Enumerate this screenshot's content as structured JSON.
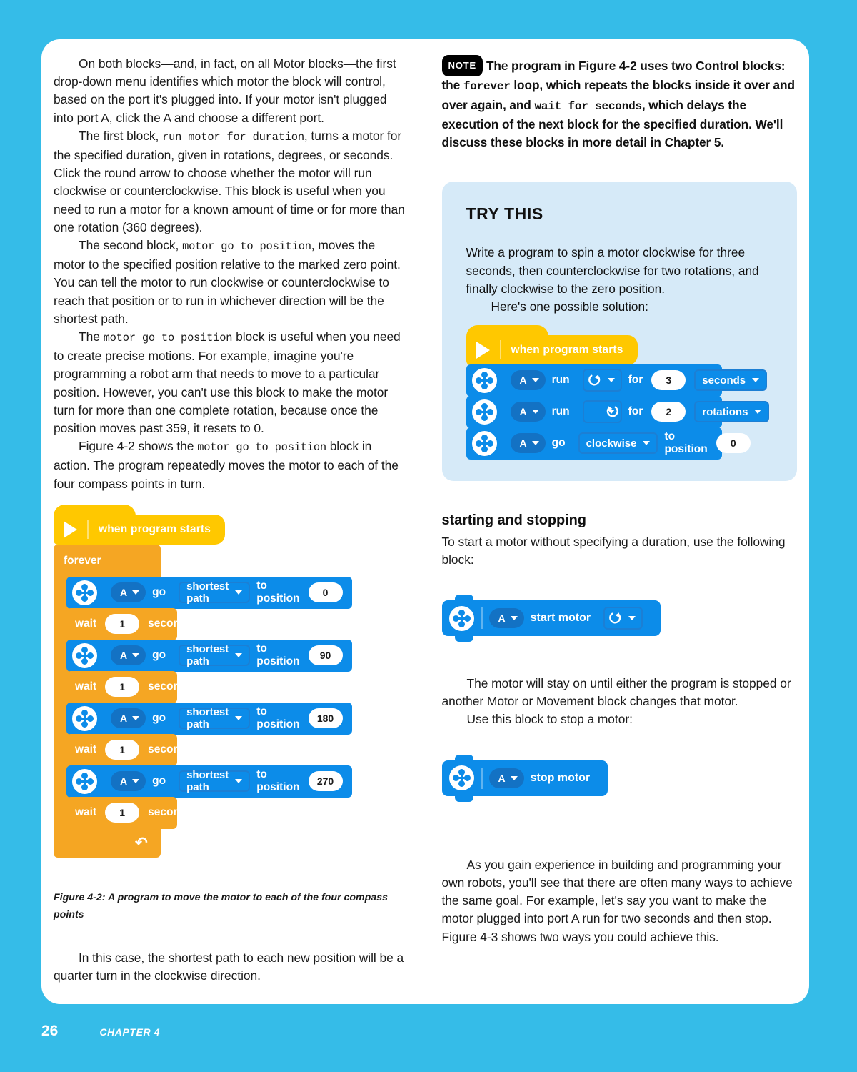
{
  "colors": {
    "page_bg": "#35BCE8",
    "paper": "#ffffff",
    "motor_block": "#0C8CE9",
    "control_block": "#F5A623",
    "event_block": "#FFC800",
    "trythis_bg": "#D6EAF8"
  },
  "left_column": {
    "paragraphs": [
      {
        "id": "p1",
        "runs": [
          {
            "t": "On both blocks—and, in fact, on all Motor blocks—the first drop-down menu identifies which motor the block will control, based on the port it's plugged into. If your motor isn't plugged into port A, click the A and choose a different port.",
            "mono": false
          }
        ]
      },
      {
        "id": "p2",
        "runs": [
          {
            "t": "The first block, ",
            "mono": false
          },
          {
            "t": "run motor for duration",
            "mono": true
          },
          {
            "t": ", turns a motor for the specified duration, given in rotations, degrees, or seconds. Click the round arrow to choose whether the motor will run clockwise or counterclockwise. This block is useful when you need to run a motor for a known amount of time or for more than one rotation (360 degrees).",
            "mono": false
          }
        ]
      },
      {
        "id": "p3",
        "runs": [
          {
            "t": "The second block, ",
            "mono": false
          },
          {
            "t": "motor go to position",
            "mono": true
          },
          {
            "t": ", moves the motor to the specified position relative to the marked zero point. You can tell the motor to run clockwise or counterclockwise to reach that position or to run in whichever direction will be the shortest path.",
            "mono": false
          }
        ]
      },
      {
        "id": "p4",
        "runs": [
          {
            "t": " The ",
            "mono": false
          },
          {
            "t": "motor go to position",
            "mono": true
          },
          {
            "t": " block is useful when you need to create precise motions. For example, imagine you're programming a robot arm that needs to move to a particular position. However, you can't use this block to make the motor turn for more than one complete rotation, because once the position moves past 359, it resets to 0.",
            "mono": false
          }
        ]
      },
      {
        "id": "p5",
        "runs": [
          {
            "t": "Figure 4-2 shows the ",
            "mono": false
          },
          {
            "t": "motor go to position",
            "mono": true
          },
          {
            "t": " block in action. The program repeatedly moves the motor to each of the four compass points in turn.",
            "mono": false
          }
        ]
      }
    ],
    "figure": {
      "hat_label": "when program starts",
      "loop_label": "forever",
      "steps": [
        {
          "type": "motor",
          "port": "A",
          "verb": "go",
          "mode": "shortest path",
          "to_label": "to position",
          "value": "0"
        },
        {
          "type": "wait",
          "wait_label": "wait",
          "value": "1",
          "unit_label": "seconds"
        },
        {
          "type": "motor",
          "port": "A",
          "verb": "go",
          "mode": "shortest path",
          "to_label": "to position",
          "value": "90"
        },
        {
          "type": "wait",
          "wait_label": "wait",
          "value": "1",
          "unit_label": "seconds"
        },
        {
          "type": "motor",
          "port": "A",
          "verb": "go",
          "mode": "shortest path",
          "to_label": "to position",
          "value": "180"
        },
        {
          "type": "wait",
          "wait_label": "wait",
          "value": "1",
          "unit_label": "seconds"
        },
        {
          "type": "motor",
          "port": "A",
          "verb": "go",
          "mode": "shortest path",
          "to_label": "to position",
          "value": "270"
        },
        {
          "type": "wait",
          "wait_label": "wait",
          "value": "1",
          "unit_label": "seconds"
        }
      ],
      "caption": "Figure 4-2: A program to move the motor to each of the four compass points"
    },
    "closing_paragraph": "In this case, the shortest path to each new position will be a quarter turn in the clockwise direction."
  },
  "right_column": {
    "note": {
      "badge": "NOTE",
      "runs": [
        {
          "t": "The program in Figure 4-2 uses two Control blocks: the ",
          "mono": false
        },
        {
          "t": "forever",
          "mono": true
        },
        {
          "t": " loop, which repeats the blocks inside it over and over again, and ",
          "mono": false
        },
        {
          "t": "wait for seconds",
          "mono": true
        },
        {
          "t": ", which delays the execution of the next block for the specified duration. We'll discuss these blocks in more detail in Chapter 5.",
          "mono": false
        }
      ]
    },
    "trythis": {
      "heading": "TRY THIS",
      "paragraph": "Write a program to spin a motor clockwise for three seconds, then counterclockwise for two rotations, and finally clockwise to the zero position.",
      "paragraph2": "Here's one possible solution:",
      "program": {
        "hat_label": "when program starts",
        "steps": [
          {
            "type": "run",
            "port": "A",
            "verb": "run",
            "direction": "clockwise",
            "for_label": "for",
            "value": "3",
            "unit": "seconds"
          },
          {
            "type": "run",
            "port": "A",
            "verb": "run",
            "direction": "counterclockwise",
            "for_label": "for",
            "value": "2",
            "unit": "rotations"
          },
          {
            "type": "goto",
            "port": "A",
            "verb": "go",
            "mode": "clockwise",
            "to_label": "to position",
            "value": "0"
          }
        ]
      }
    },
    "subhead": "starting and stopping",
    "paragraph_start": "To start a motor without specifying a duration, use the following block:",
    "start_block": {
      "port": "A",
      "label": "start motor",
      "direction": "clockwise"
    },
    "paragraph_stayon": "The motor will stay on until either the program is stopped or another Motor or Movement block changes that motor.",
    "paragraph_usethis": "Use this block to stop a motor:",
    "stop_block": {
      "port": "A",
      "label": "stop motor"
    },
    "paragraph_final": "As you gain experience in building and programming your own robots, you'll see that there are often many ways to achieve the same goal. For example, let's say you want to make the motor plugged into port A run for two seconds and then stop. Figure 4-3 shows two ways you could achieve this."
  },
  "footer": {
    "page_number": "26",
    "chapter": "CHAPTER 4"
  }
}
